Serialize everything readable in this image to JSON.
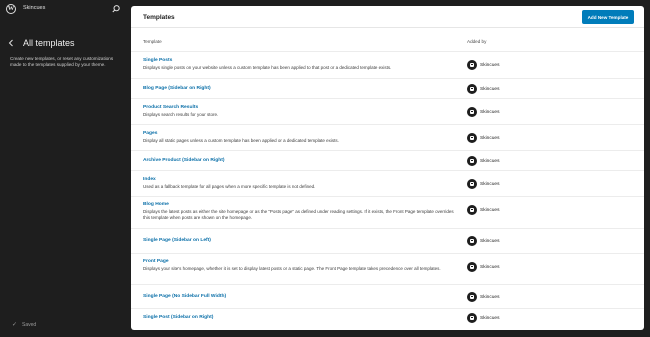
{
  "sidebar": {
    "site_name": "Skincues",
    "title": "All templates",
    "description": "Create new templates, or reset any customizations made to the templates supplied by your theme.",
    "status": "Saved"
  },
  "main": {
    "title": "Templates",
    "add_button": "Add New Template",
    "columns": {
      "template": "Template",
      "added_by": "Added by"
    },
    "rows": [
      {
        "name": "Single Posts",
        "description": "Displays single posts on your website unless a custom template has been applied to that post or a dedicated template exists.",
        "added_by": "Skincues"
      },
      {
        "name": "Blog Page (Sidebar on Right)",
        "description": "",
        "added_by": "Skincues"
      },
      {
        "name": "Product Search Results",
        "description": "Displays search results for your store.",
        "added_by": "Skincues"
      },
      {
        "name": "Pages",
        "description": "Display all static pages unless a custom template has been applied or a dedicated template exists.",
        "added_by": "Skincues"
      },
      {
        "name": "Archive Product (Sidebar on Right)",
        "description": "",
        "added_by": "Skincues"
      },
      {
        "name": "Index",
        "description": "Used as a fallback template for all pages when a more specific template is not defined.",
        "added_by": "Skincues"
      },
      {
        "name": "Blog Home",
        "description": "Displays the latest posts as either the site homepage or as the \"Posts page\" as defined under reading settings. If it exists, the Front Page template overrides this template when posts are shown on the homepage.",
        "added_by": "Skincues"
      },
      {
        "name": "Single Page (Sidebar on Left)",
        "description": "",
        "added_by": "Skincues"
      },
      {
        "name": "Front Page",
        "description": "Displays your site's homepage, whether it is set to display latest posts or a static page. The Front Page template takes precedence over all templates.",
        "added_by": "Skincues"
      },
      {
        "name": "Single Page (No Sidebar Full Width)",
        "description": "",
        "added_by": "Skincues"
      },
      {
        "name": "Single Post (Sidebar on Right)",
        "description": "",
        "added_by": "Skincues"
      }
    ]
  },
  "colors": {
    "accent": "#007cba",
    "link": "#0a6fa8",
    "sidebar_bg": "#1e1e1e"
  },
  "icons": [
    "wordpress-logo-icon",
    "search-icon",
    "chevron-left-icon",
    "check-icon",
    "template-author-icon"
  ]
}
